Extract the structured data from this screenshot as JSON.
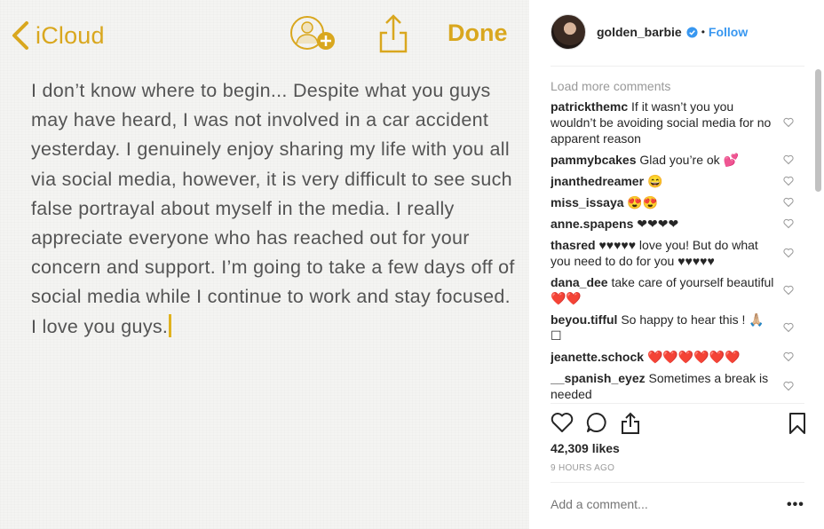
{
  "notes": {
    "back_label": "iCloud",
    "done_label": "Done",
    "body": "I don’t know where to begin... Despite what you guys may have heard, I was not involved in a car accident yesterday. I genuinely enjoy sharing my life with you all via social media, however, it is very difficult to see such false portrayal about myself in the media. I really appreciate everyone who has reached out for your concern and support. I’m going to take a few days off of social media while I continue to work and stay focused. I love you guys.",
    "accent_color": "#d9a71e"
  },
  "post": {
    "username": "golden_barbie",
    "follow_label": "Follow",
    "load_more": "Load more comments",
    "comments": [
      {
        "user": "patrickthemc",
        "text": "If it wasn’t you you wouldn’t be avoiding social media for no apparent reason"
      },
      {
        "user": "pammybcakes",
        "text": "Glad you’re ok 💕"
      },
      {
        "user": "jnanthedreamer",
        "text": "😄"
      },
      {
        "user": "miss_issaya",
        "text": "😍😍"
      },
      {
        "user": "anne.spapens",
        "text": "❤❤❤❤"
      },
      {
        "user": "thasred",
        "text": "♥♥♥♥♥ love you! But do what you need to do for you ♥♥♥♥♥"
      },
      {
        "user": "dana_dee",
        "text": "take care of yourself beautiful ❤️❤️"
      },
      {
        "user": "beyou.tifful",
        "text": "So happy to hear this ! 🙏🏼☐"
      },
      {
        "user": "jeanette.schock",
        "text": "❤️❤️❤️❤️❤️❤️"
      },
      {
        "user": "__spanish_eyez",
        "text": "Sometimes a break is needed"
      }
    ],
    "likes": "42,309 likes",
    "time": "9 HOURS AGO",
    "add_comment_placeholder": "Add a comment...",
    "more_label": "•••",
    "link_color": "#3897f0"
  }
}
